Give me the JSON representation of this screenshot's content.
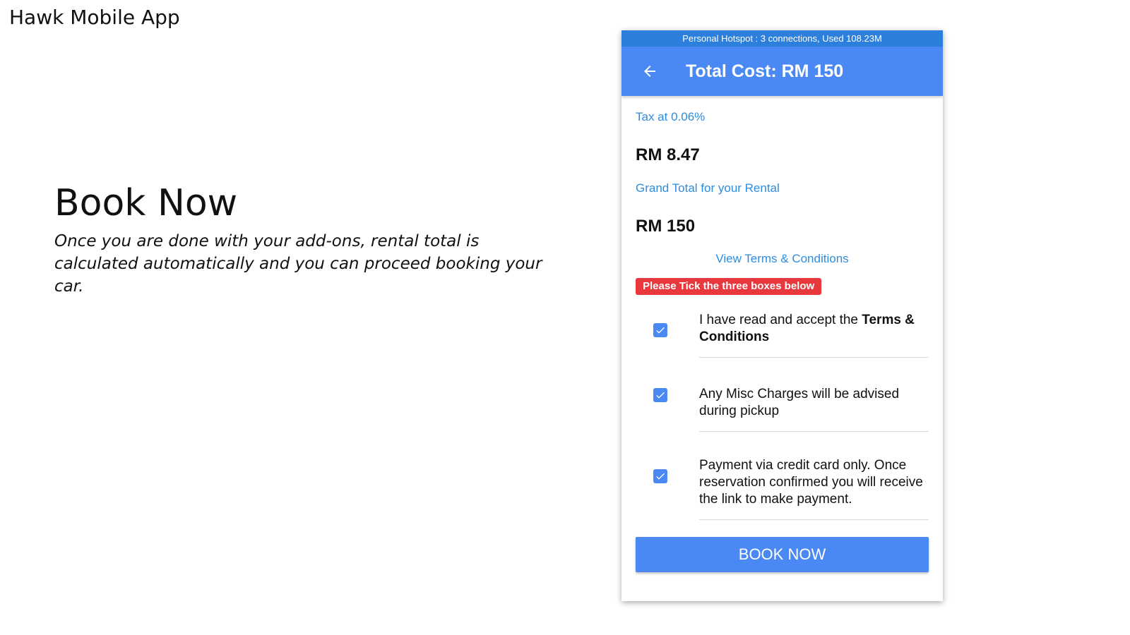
{
  "slide": {
    "title": "Hawk Mobile App",
    "heading": "Book Now",
    "description": "Once you are done with your add-ons, rental total is calculated automatically and you can proceed booking your car."
  },
  "status_bar": {
    "text": "Personal Hotspot : 3 connections, Used 108.23M"
  },
  "app_bar": {
    "back_icon": "arrow-left-icon",
    "title": "Total Cost: RM 150"
  },
  "summary": {
    "tax_label": "Tax at 0.06%",
    "tax_amount": "RM 8.47",
    "grand_total_label": "Grand Total for your Rental",
    "grand_total_amount": "RM 150",
    "terms_link": "View Terms & Conditions"
  },
  "warning": {
    "text": "Please Tick the three boxes below"
  },
  "checks": [
    {
      "text_prefix": "I have read and accept the ",
      "text_bold": "Terms & Conditions",
      "checked": true
    },
    {
      "text": "Any Misc Charges will be advised during pickup",
      "checked": true
    },
    {
      "text": "Payment via credit card only. Once reservation confirmed you will receive the link to make payment.",
      "checked": true
    }
  ],
  "book_button": {
    "label": "BOOK NOW"
  },
  "colors": {
    "status_bar": "#2d7fdc",
    "app_bar": "#4a89f3",
    "link": "#2d8ce0",
    "warning": "#e8383d",
    "checkbox": "#4a89f3"
  }
}
